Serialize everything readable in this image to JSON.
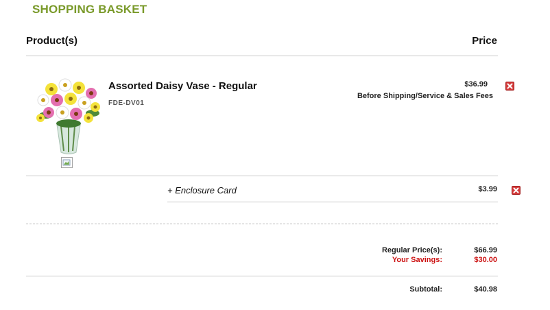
{
  "basket": {
    "title": "SHOPPING BASKET",
    "header": {
      "products_label": "Product(s)",
      "price_label": "Price"
    },
    "item": {
      "name": "Assorted Daisy Vase - Regular",
      "code": "FDE-DV01",
      "price": "$36.99",
      "price_note": "Before Shipping/Service & Sales Fees",
      "image_name": "daisy-vase-image",
      "remove_icon": "remove-icon"
    },
    "addon": {
      "label": "+ Enclosure Card",
      "price": "$3.99",
      "remove_icon": "remove-icon"
    },
    "summary": {
      "regular_label": "Regular Price(s):",
      "regular_value": "$66.99",
      "savings_label": "Your Savings:",
      "savings_value": "$30.00",
      "subtotal_label": "Subtotal:",
      "subtotal_value": "$40.98"
    },
    "colors": {
      "title": "#7a9a2a",
      "savings": "#cc1111",
      "remove": "#d33a3a"
    }
  }
}
